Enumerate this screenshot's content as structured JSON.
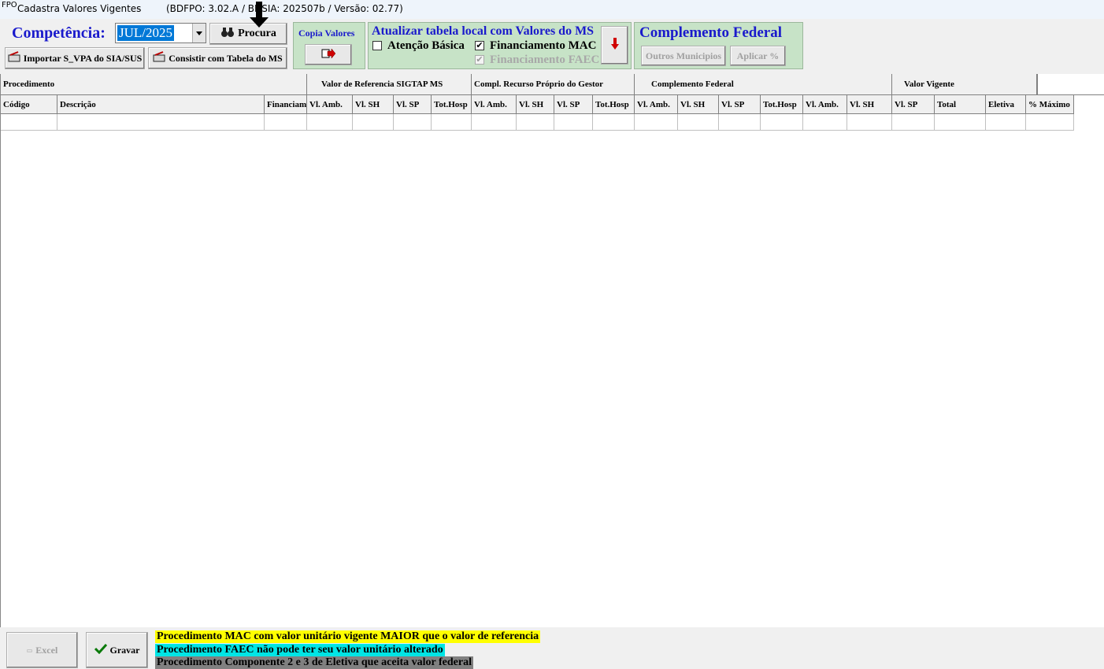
{
  "titlebar": {
    "icon": "FPO",
    "app_name": "Cadastra Valores Vigentes",
    "separator": "-",
    "version_info": "(BDFPO: 3.02.A / BDSIA: 202507b / Versão: 02.77)"
  },
  "toolbar": {
    "competencia_label": "Competência:",
    "competencia_value": "JUL/2025",
    "procura_label": "Procura",
    "importar_label": "Importar S_VPA do SIA/SUS",
    "consistir_label": "Consistir com Tabela do MS",
    "copia_valores_label": "Copia Valores"
  },
  "atualizar": {
    "title": "Atualizar tabela local com Valores do MS",
    "atencao_basica": {
      "label": "Atenção Básica",
      "checked": false
    },
    "financiamento_mac": {
      "label": "Financiamento MAC",
      "checked": true
    },
    "financiamento_faec": {
      "label": "Financiamento FAEC",
      "checked": true,
      "disabled": true
    }
  },
  "complemento": {
    "title": "Complemento Federal",
    "outros_label": "Outros Municipios",
    "aplicar_label": "Aplicar %"
  },
  "grid": {
    "group_headers": [
      "Procedimento",
      "Valor de Referencia SIGTAP MS",
      "Compl. Recurso Próprio do Gestor",
      "Complemento Federal",
      "Valor Vigente",
      ""
    ],
    "columns": [
      "Código",
      "Descrição",
      "Financiam",
      "Vl. Amb.",
      "Vl. SH",
      "Vl. SP",
      "Tot.Hosp",
      "Vl. Amb.",
      "Vl. SH",
      "Vl. SP",
      "Tot.Hosp",
      "Vl. Amb.",
      "Vl. SH",
      "Vl. SP",
      "Tot.Hosp",
      "Vl. Amb.",
      "Vl. SH",
      "Vl. SP",
      "Total",
      "Eletiva",
      "% Máximo"
    ]
  },
  "footer": {
    "excel_label": "Excel",
    "gravar_label": "Gravar",
    "legend": [
      {
        "text": "Procedimento MAC com valor unitário vigente MAIOR que o valor de referencia",
        "color": "#ffff00"
      },
      {
        "text": "Procedimento FAEC não pode ter seu valor unitário alterado",
        "color": "#00e5e5"
      },
      {
        "text": "Procedimento Componente 2 e 3 de Eletiva que aceita valor federal",
        "color": "#808080"
      }
    ]
  }
}
